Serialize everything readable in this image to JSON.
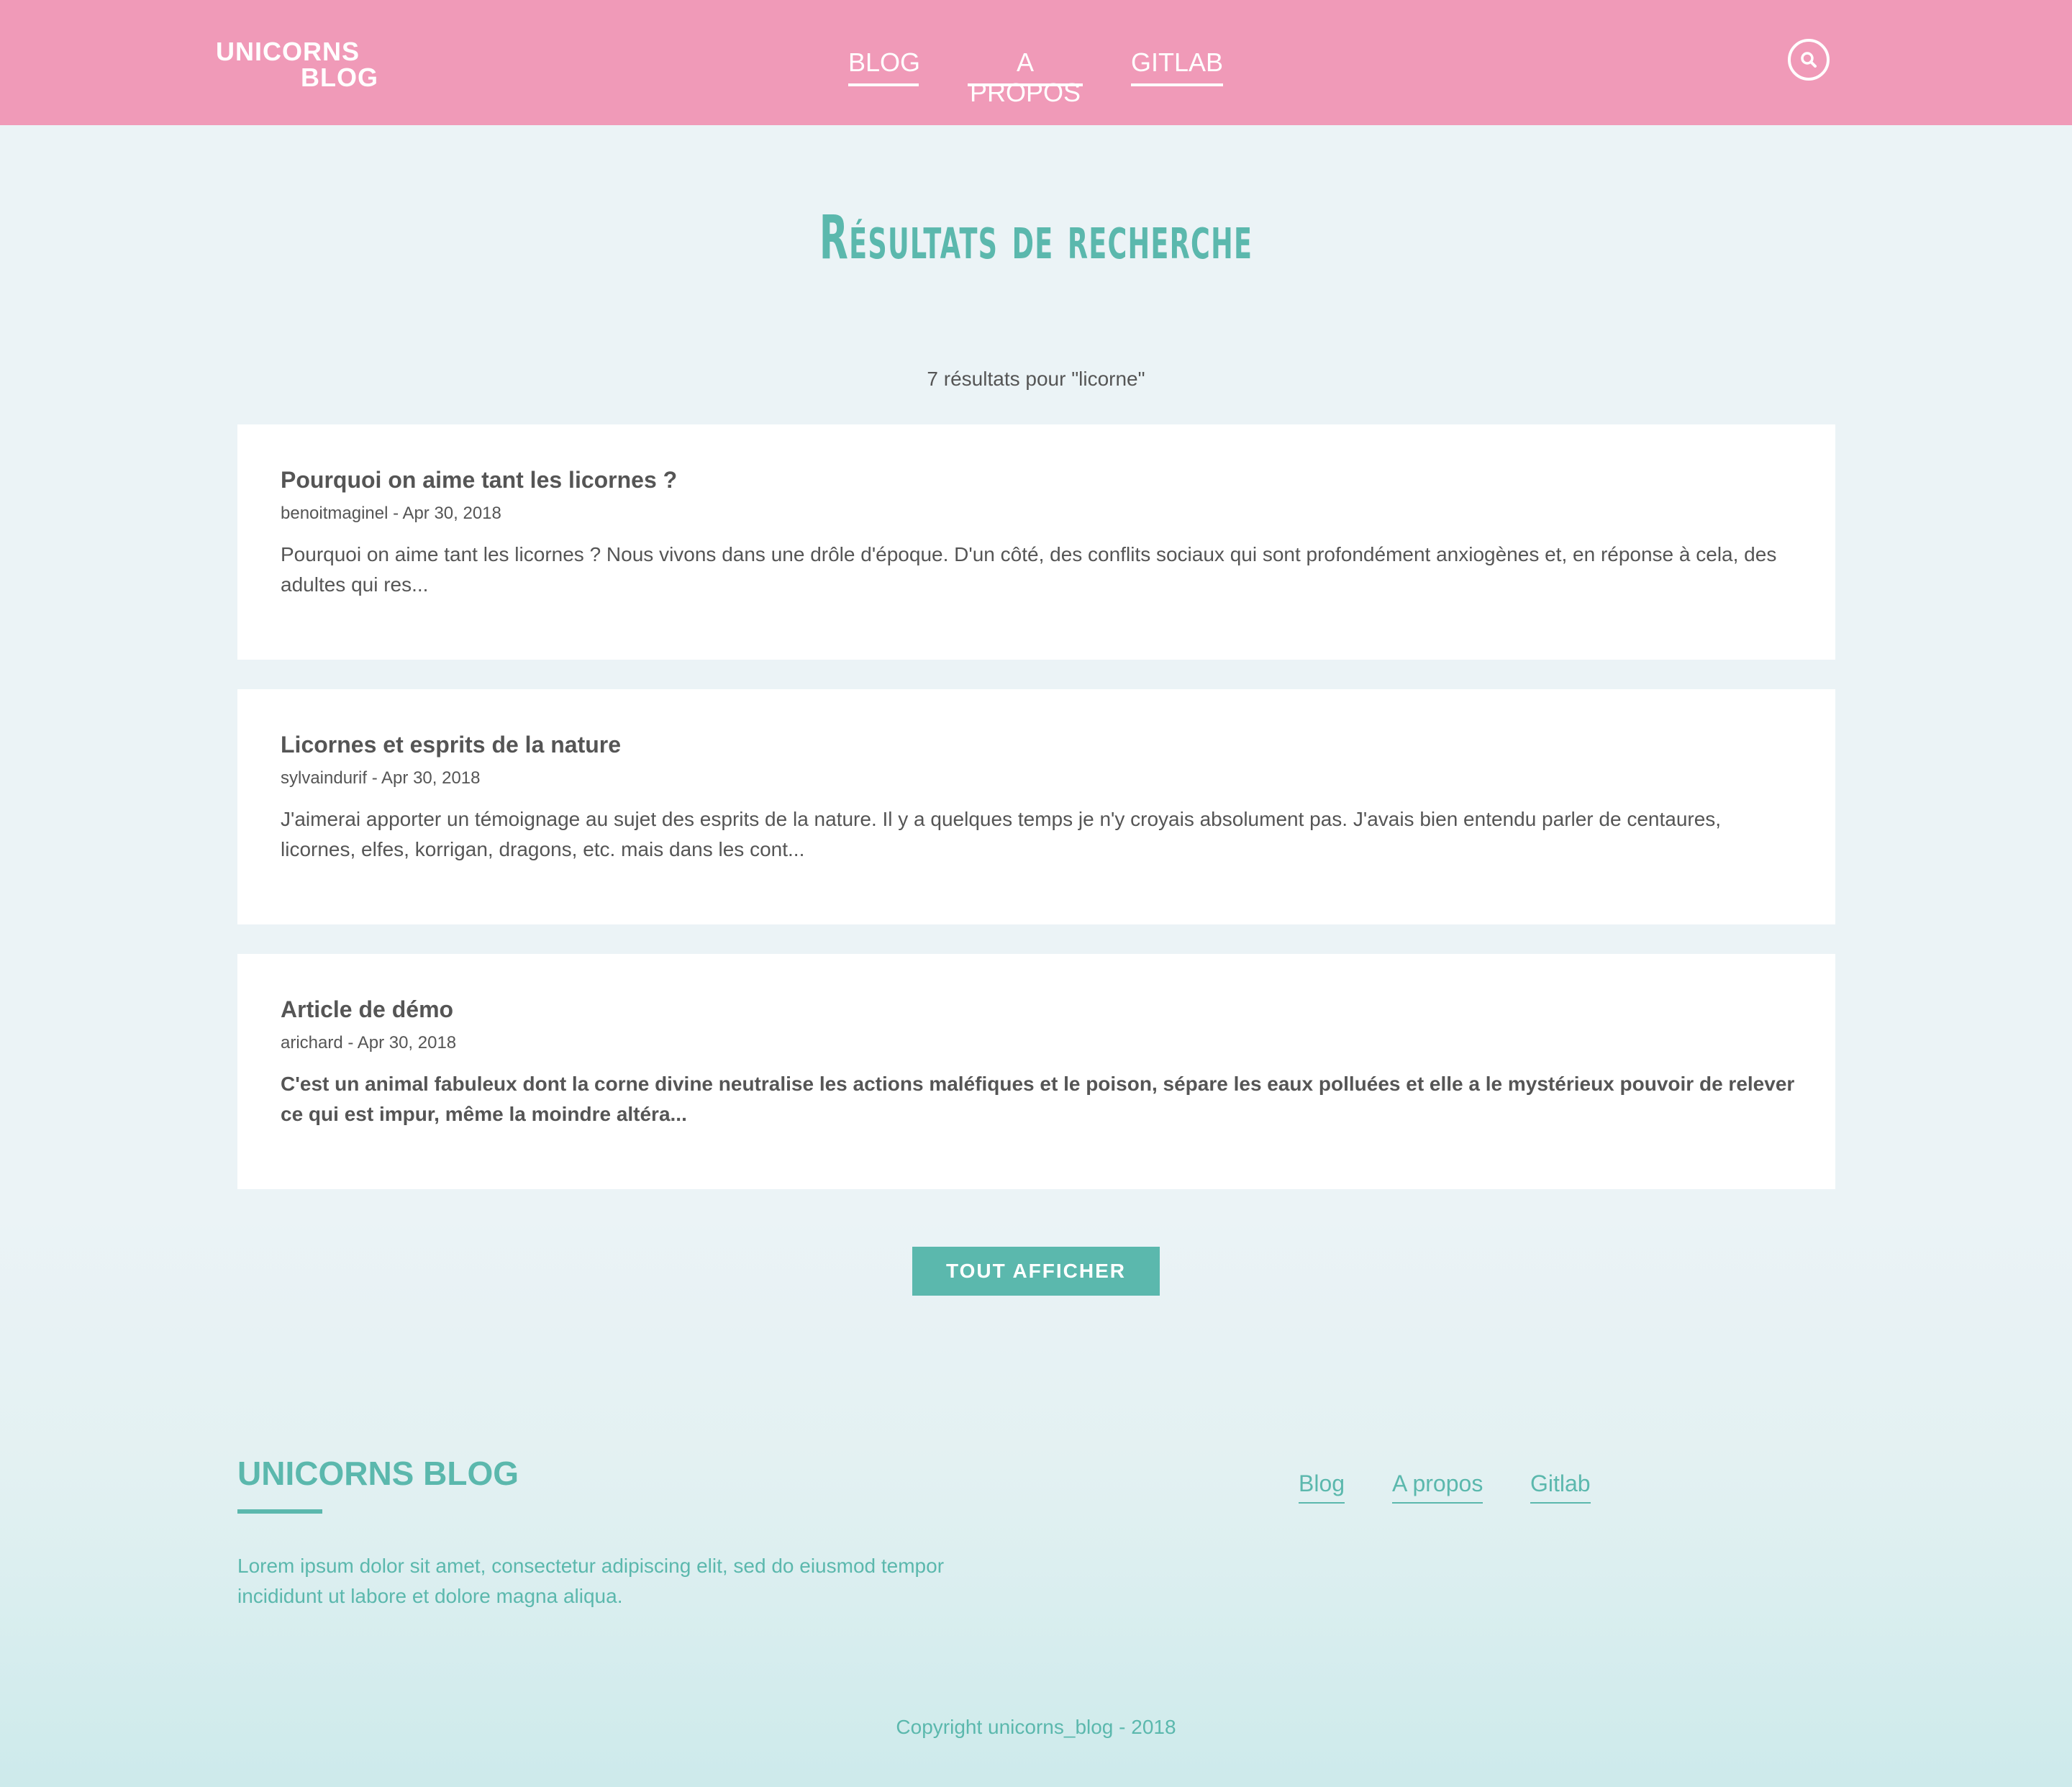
{
  "header": {
    "logo_line1": "UNICORNS",
    "logo_line2": "BLOG",
    "nav": [
      {
        "label": "BLOG"
      },
      {
        "label": "A PROPOS"
      },
      {
        "label": "GITLAB"
      }
    ],
    "search_icon": "search-icon"
  },
  "main": {
    "title": "Résultats de recherche",
    "results_count": "7 résultats pour \"licorne\"",
    "results": [
      {
        "title": "Pourquoi on aime tant les licornes ?",
        "meta": "benoitmaginel - Apr 30, 2018",
        "excerpt": "Pourquoi on aime tant les licornes ? Nous vivons dans une drôle d'époque. D'un côté, des conflits sociaux qui sont profondément anxiogènes et, en réponse à cela, des adultes qui res..."
      },
      {
        "title": "Licornes et esprits de la nature",
        "meta": "sylvaindurif - Apr 30, 2018",
        "excerpt": "J'aimerai apporter un témoignage au sujet des esprits de la nature. Il y a quelques temps je n'y croyais absolument pas. J'avais bien entendu parler de centaures, licornes, elfes, korrigan, dragons, etc. mais dans les cont..."
      },
      {
        "title": "Article de démo",
        "meta": "arichard - Apr 30, 2018",
        "excerpt": "C'est un animal fabuleux dont la corne divine neutralise les actions maléfiques et le poison, sépare les eaux polluées et elle a le mystérieux pouvoir de relever ce qui est impur, même la moindre altéra..."
      }
    ],
    "show_all_label": "TOUT AFFICHER"
  },
  "footer": {
    "brand": "UNICORNS BLOG",
    "description": "Lorem ipsum dolor sit amet, consectetur adipiscing elit, sed do eiusmod tempor incididunt ut labore et dolore magna aliqua.",
    "links": [
      {
        "label": "Blog"
      },
      {
        "label": "A propos"
      },
      {
        "label": "Gitlab"
      }
    ],
    "copyright": "Copyright unicorns_blog - 2018"
  },
  "colors": {
    "header_bg": "#f09ab8",
    "accent": "#5bb8ad",
    "text": "#555555",
    "page_bg": "#ebf3f6"
  }
}
